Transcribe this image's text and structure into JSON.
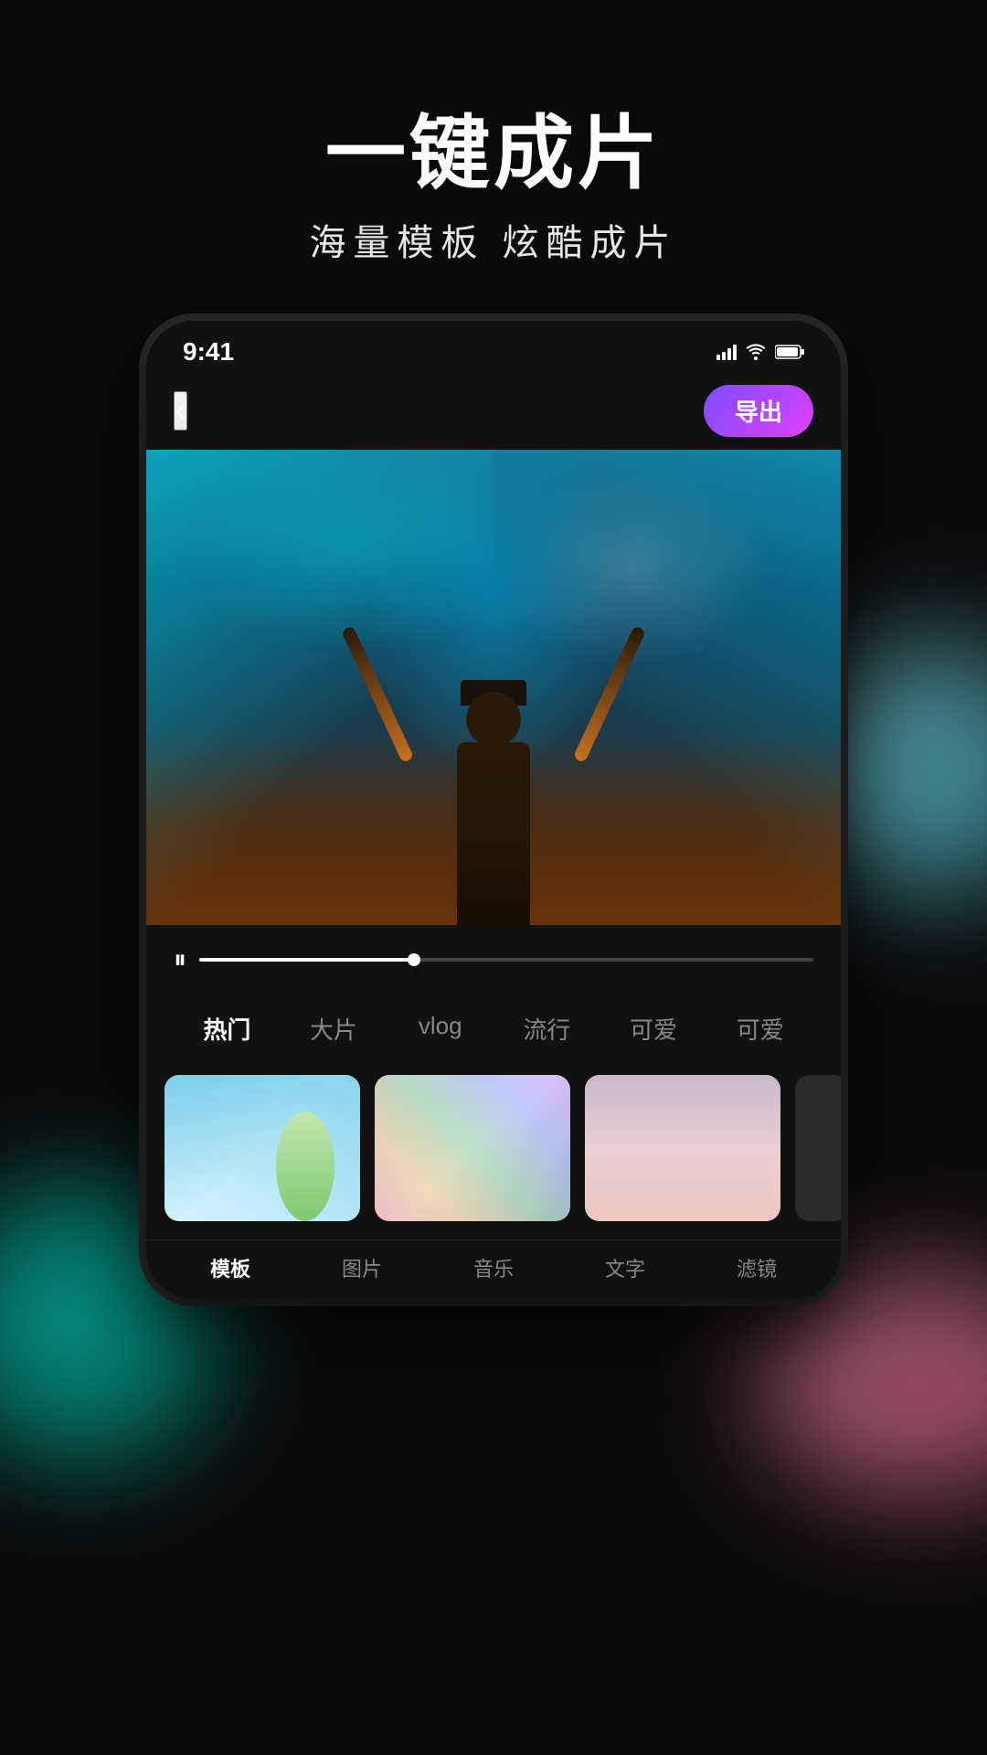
{
  "page": {
    "background_color": "#0a0a0a"
  },
  "top_text": {
    "title": "一键成片",
    "subtitle": "海量模板  炫酷成片"
  },
  "status_bar": {
    "time": "9:41"
  },
  "toolbar": {
    "back_label": "‹",
    "export_label": "导出"
  },
  "category_tabs": {
    "items": [
      {
        "label": "热门",
        "active": true
      },
      {
        "label": "大片",
        "active": false
      },
      {
        "label": "vlog",
        "active": false
      },
      {
        "label": "流行",
        "active": false
      },
      {
        "label": "可爱",
        "active": false
      },
      {
        "label": "可爱",
        "active": false
      }
    ]
  },
  "bottom_nav": {
    "items": [
      {
        "label": "模板",
        "active": true
      },
      {
        "label": "图片",
        "active": false
      },
      {
        "label": "音乐",
        "active": false
      },
      {
        "label": "文字",
        "active": false
      },
      {
        "label": "滤镜",
        "active": false
      }
    ]
  },
  "icons": {
    "play_pause": "⏸",
    "back_arrow": "‹",
    "signal": "▐▐▐▐",
    "wifi": "wifi",
    "battery": "battery"
  }
}
